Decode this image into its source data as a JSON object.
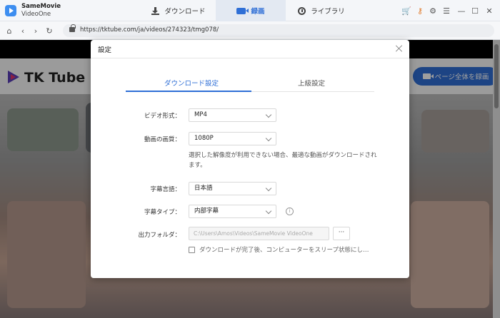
{
  "app": {
    "name": "SameMovie",
    "subname": "VideoOne"
  },
  "tabs": [
    {
      "label": "ダウンロード"
    },
    {
      "label": "録画"
    },
    {
      "label": "ライブラリ"
    }
  ],
  "browser": {
    "url": "https://tktube.com/ja/videos/274323/tmg078/"
  },
  "webpage": {
    "logo_text": "TK Tube",
    "record_button": "ページ全体を録画"
  },
  "dialog": {
    "title": "設定",
    "tabs": {
      "download": "ダウンロード設定",
      "advanced": "上級設定"
    },
    "video_format": {
      "label": "ビデオ形式：",
      "value": "MP4"
    },
    "quality": {
      "label": "動画の画質：",
      "value": "1080P",
      "note": "選択した解像度が利用できない場合、最適な動画がダウンロードされます。"
    },
    "subtitle_lang": {
      "label": "字幕言語：",
      "value": "日本語"
    },
    "subtitle_type": {
      "label": "字幕タイプ：",
      "value": "内部字幕"
    },
    "output_folder": {
      "label": "出力フォルダ：",
      "value": "C:\\Users\\Amos\\Videos\\SameMovie VideoOne",
      "browse": "···"
    },
    "sleep_option": {
      "label": "ダウンロードが完了後、コンピューターをスリープ状態にし…",
      "checked": false
    }
  },
  "colors": {
    "accent": "#2f6fd6",
    "overlay": "rgba(0,0,0,0.38)"
  }
}
